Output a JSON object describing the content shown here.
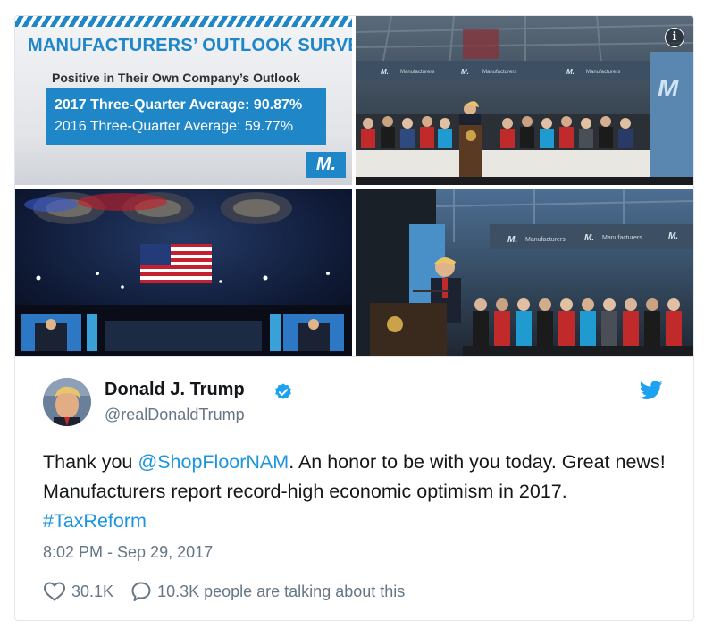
{
  "media": {
    "infographic": {
      "title": "MANUFACTURERS’ OUTLOOK SURVEY",
      "subtitle": "Positive in Their Own Company’s Outlook",
      "line_2017": "2017 Three-Quarter Average: 90.87%",
      "line_2016": "2016 Three-Quarter Average: 59.77%",
      "logo": "M."
    },
    "info_icon": "info-icon",
    "banner_text": "Manufacturers",
    "banner_logo": "M."
  },
  "tweet": {
    "author_name": "Donald J. Trump",
    "handle": "@realDonaldTrump",
    "text_parts": {
      "p1": "Thank you ",
      "mention": "@ShopFloorNAM",
      "p2": ". An honor to be with you today. Great news! Manufacturers report record-high economic optimism in 2017. ",
      "hashtag": "#TaxReform"
    },
    "timestamp": "8:02 PM - Sep 29, 2017",
    "likes": "30.1K",
    "talking": "10.3K people are talking about this"
  },
  "colors": {
    "link": "#1b95e0",
    "brand_blue": "#1f86c7",
    "muted": "#657786",
    "twitter": "#1da1f2"
  }
}
